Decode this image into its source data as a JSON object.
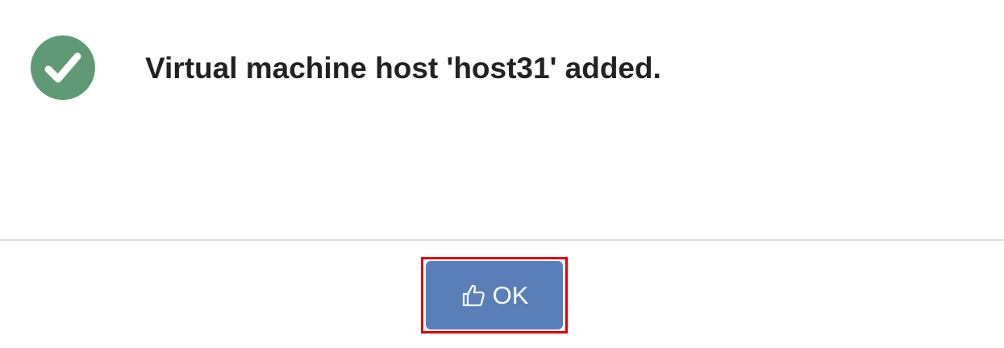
{
  "dialog": {
    "status_icon": "check-circle-icon",
    "message": "Virtual machine host 'host31' added.",
    "ok_button": {
      "label": "OK",
      "icon": "thumbs-up-icon"
    }
  },
  "colors": {
    "success": "#5f9a74",
    "button": "#5a7fb8",
    "highlight": "#e00000",
    "text": "#222222"
  }
}
